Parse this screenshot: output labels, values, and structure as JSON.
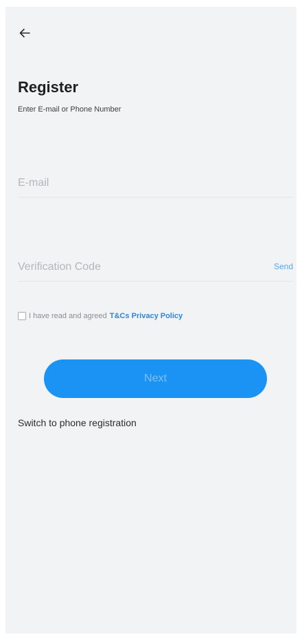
{
  "header": {
    "back_icon": "arrow-left-icon",
    "title": "Register",
    "subtitle": "Enter E-mail or Phone Number"
  },
  "form": {
    "email": {
      "value": "",
      "placeholder": "E-mail"
    },
    "verification_code": {
      "value": "",
      "placeholder": "Verification Code",
      "send_label": "Send"
    },
    "agreement": {
      "checked": false,
      "text": "I have read and agreed",
      "link_label": "T&Cs Privacy Policy"
    },
    "next_label": "Next",
    "switch_label": "Switch to phone registration"
  },
  "colors": {
    "background": "#f2f3f5",
    "primary_button": "#1a93f5",
    "link": "#2d86d9",
    "send_link": "#52a8f2"
  }
}
